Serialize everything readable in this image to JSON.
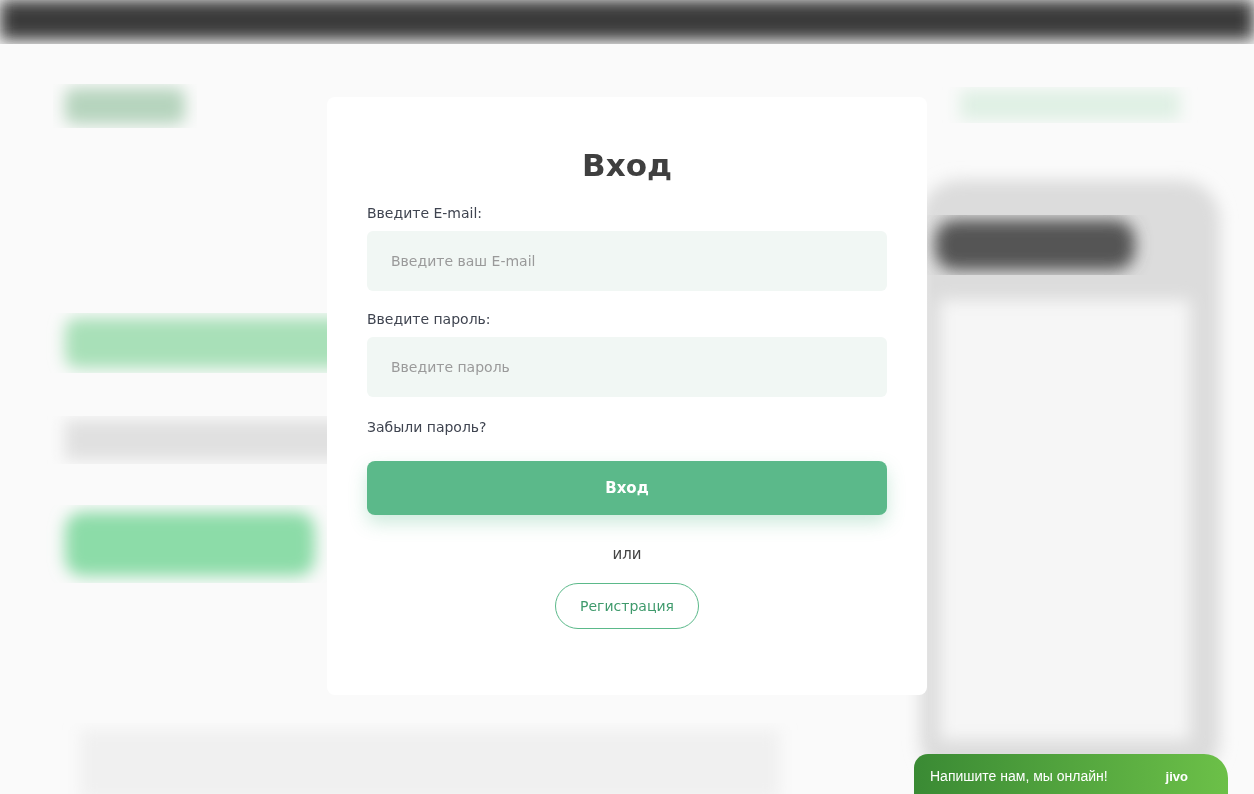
{
  "login_dialog": {
    "title": "Вход",
    "fields": [
      {
        "label": "Введите E-mail:",
        "placeholder": "Введите ваш E-mail"
      },
      {
        "label": "Введите пароль:",
        "placeholder": "Введите пароль"
      }
    ],
    "forgot_link": "Забыли пароль?",
    "submit_button": "Вход",
    "separator": "или",
    "register_button": "Регистрация"
  },
  "chat_widget": {
    "text": "Напишите нам, мы онлайн!",
    "logo": "jivo"
  }
}
